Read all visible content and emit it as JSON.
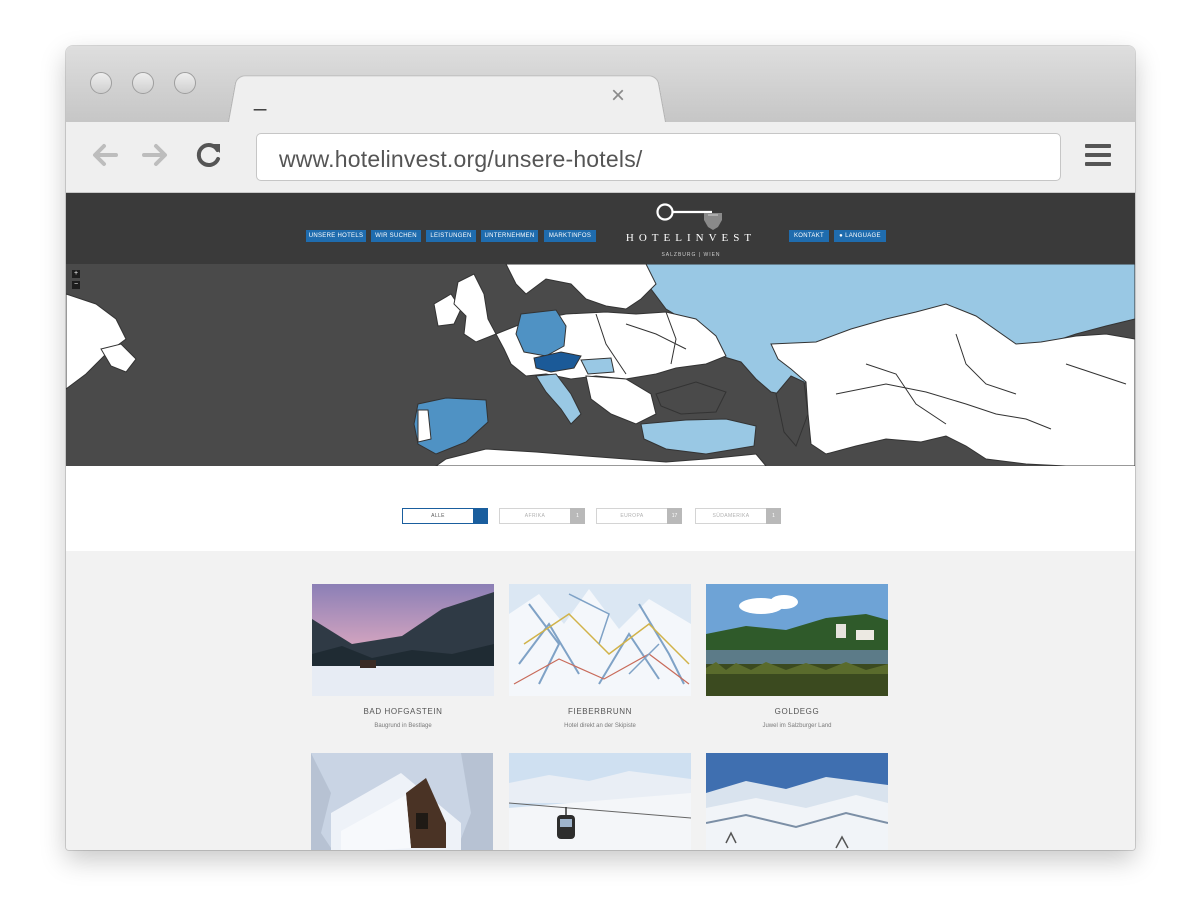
{
  "browser": {
    "tab_title": "_",
    "tab_close": "×",
    "url": "www.hotelinvest.org/unsere-hotels/"
  },
  "site": {
    "nav_items": [
      "UNSERE HOTELS",
      "WIR SUCHEN",
      "LEISTUNGEN",
      "UNTERNEHMEN",
      "MARKTINFOS"
    ],
    "logo_text": "HOTELINVEST",
    "logo_subtitle": "SALZBURG | WIEN",
    "right_nav": {
      "contact": "KONTAKT",
      "language": "LANGUAGE"
    },
    "map_zoom": {
      "in": "+",
      "out": "−"
    }
  },
  "filters": [
    {
      "label": "ALLE",
      "count": "",
      "active": true
    },
    {
      "label": "AFRIKA",
      "count": "1",
      "active": false
    },
    {
      "label": "EUROPA",
      "count": "17",
      "active": false
    },
    {
      "label": "SÜDAMERIKA",
      "count": "1",
      "active": false
    }
  ],
  "hotels": [
    {
      "title": "BAD HOFGASTEIN",
      "subtitle": "Baugrund in Bestlage"
    },
    {
      "title": "FIEBERBRUNN",
      "subtitle": "Hotel direkt an der Skipiste"
    },
    {
      "title": "GOLDEGG",
      "subtitle": "Juwel im Salzburger Land"
    },
    {
      "title": "",
      "subtitle": ""
    },
    {
      "title": "",
      "subtitle": ""
    },
    {
      "title": "",
      "subtitle": ""
    }
  ],
  "colors": {
    "header_bg": "#3a3a3a",
    "nav_pill": "#1f6cae",
    "map_dark": "#4a4a4a",
    "map_light_blue": "#99c8e4",
    "map_mid_blue": "#4f92c4",
    "map_dark_blue": "#1b5a98"
  }
}
